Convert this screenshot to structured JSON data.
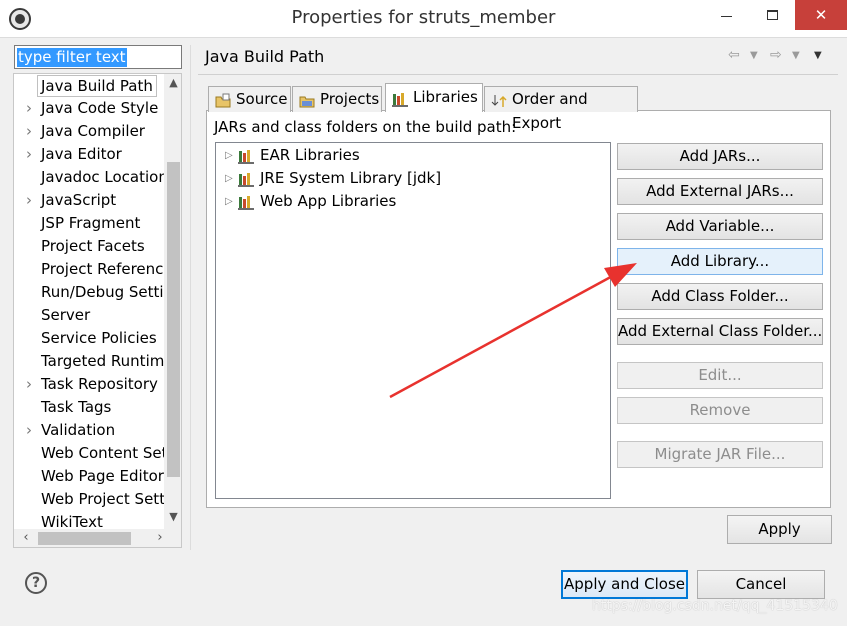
{
  "window": {
    "title": "Properties for struts_member",
    "icon": "eclipse-icon",
    "controls": [
      "minimize-icon",
      "maximize-icon",
      "close-icon"
    ]
  },
  "sidebar": {
    "filter_placeholder": "type filter text",
    "items": [
      {
        "label": "Java Build Path",
        "expandable": false,
        "selected": true
      },
      {
        "label": "Java Code Style",
        "expandable": true
      },
      {
        "label": "Java Compiler",
        "expandable": true
      },
      {
        "label": "Java Editor",
        "expandable": true
      },
      {
        "label": "Javadoc Location",
        "expandable": false
      },
      {
        "label": "JavaScript",
        "expandable": true
      },
      {
        "label": "JSP Fragment",
        "expandable": false
      },
      {
        "label": "Project Facets",
        "expandable": false
      },
      {
        "label": "Project References",
        "expandable": false
      },
      {
        "label": "Run/Debug Settings",
        "expandable": false
      },
      {
        "label": "Server",
        "expandable": false
      },
      {
        "label": "Service Policies",
        "expandable": false
      },
      {
        "label": "Targeted Runtimes",
        "expandable": false
      },
      {
        "label": "Task Repository",
        "expandable": true
      },
      {
        "label": "Task Tags",
        "expandable": false
      },
      {
        "label": "Validation",
        "expandable": true
      },
      {
        "label": "Web Content Settings",
        "expandable": false
      },
      {
        "label": "Web Page Editor",
        "expandable": false
      },
      {
        "label": "Web Project Settings",
        "expandable": false
      },
      {
        "label": "WikiText",
        "expandable": false
      }
    ]
  },
  "main": {
    "page_title": "Java Build Path",
    "nav_icons": [
      "back-arrow-icon",
      "dropdown-icon",
      "forward-arrow-icon",
      "dropdown-icon",
      "menu-icon"
    ],
    "tabs": [
      {
        "label": "Source",
        "icon": "source-folder-icon"
      },
      {
        "label": "Projects",
        "icon": "projects-folder-icon"
      },
      {
        "label": "Libraries",
        "icon": "library-icon",
        "active": true
      },
      {
        "label": "Order and Export",
        "icon": "order-export-icon"
      }
    ],
    "caption": "JARs and class folders on the build path:",
    "libraries": [
      {
        "label": "EAR Libraries"
      },
      {
        "label": "JRE System Library [jdk]"
      },
      {
        "label": "Web App Libraries"
      }
    ],
    "buttons": [
      {
        "label": "Add JARs...",
        "state": "normal"
      },
      {
        "label": "Add External JARs...",
        "state": "normal"
      },
      {
        "label": "Add Variable...",
        "state": "normal"
      },
      {
        "label": "Add Library...",
        "state": "hover"
      },
      {
        "label": "Add Class Folder...",
        "state": "normal"
      },
      {
        "label": "Add External Class Folder...",
        "state": "normal"
      },
      {
        "label": "Edit...",
        "state": "disabled"
      },
      {
        "label": "Remove",
        "state": "disabled"
      },
      {
        "label": "Migrate JAR File...",
        "state": "disabled"
      }
    ],
    "apply_label": "Apply"
  },
  "footer": {
    "help_icon": "help-icon",
    "apply_close_label": "Apply and Close",
    "cancel_label": "Cancel",
    "watermark": "https://blog.csdn.net/qq_41515340"
  },
  "colors": {
    "selection": "#3399ff",
    "default_button_border": "#0078d7",
    "hover_button_bg": "#e5f1fb",
    "annotation_arrow": "#e8322e",
    "close_button": "#c7403a"
  }
}
